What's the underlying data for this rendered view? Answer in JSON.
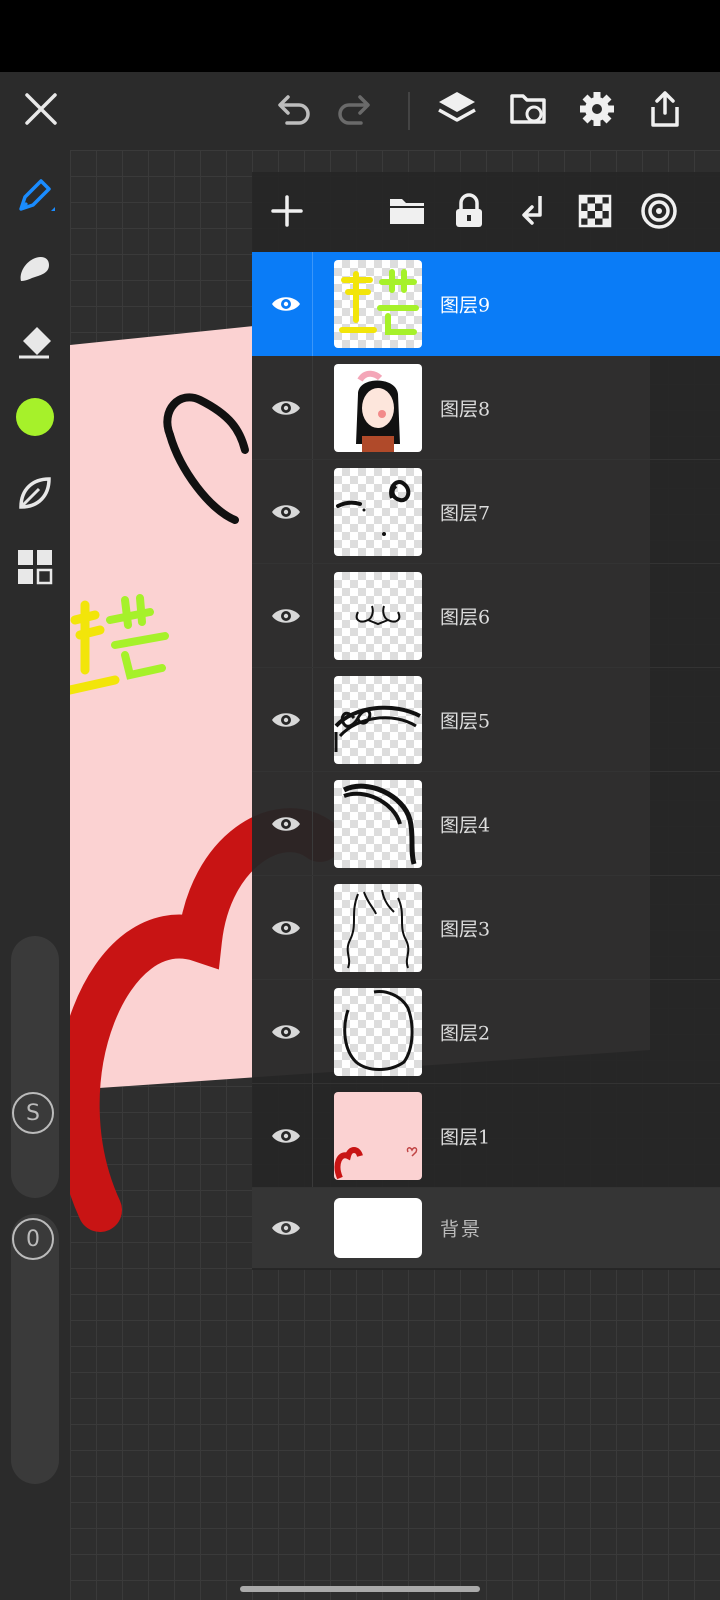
{
  "topbar": {
    "icons": [
      "close-icon",
      "undo-icon",
      "redo-icon",
      "layers-icon",
      "import-icon",
      "settings-icon",
      "share-icon"
    ]
  },
  "left_toolbar": {
    "tools": [
      "brush-icon",
      "smudge-icon",
      "eraser-icon",
      "color-swatch",
      "leaf-icon",
      "grid-icon"
    ],
    "current_color": "#a6f12a",
    "accent": "#1a8cff",
    "size_slider_label": "S",
    "opacity_slider_label": "0"
  },
  "layers_panel": {
    "tools": [
      "add-layer-icon",
      "folder-icon",
      "lock-icon",
      "merge-down-icon",
      "transparency-icon",
      "blend-icon"
    ],
    "selected_color": "#0a7cf7",
    "layers": [
      {
        "name": "图层9",
        "selected": true
      },
      {
        "name": "图层8",
        "selected": false
      },
      {
        "name": "图层7",
        "selected": false
      },
      {
        "name": "图层6",
        "selected": false
      },
      {
        "name": "图层5",
        "selected": false
      },
      {
        "name": "图层4",
        "selected": false
      },
      {
        "name": "图层3",
        "selected": false
      },
      {
        "name": "图层2",
        "selected": false
      },
      {
        "name": "图层1",
        "selected": false
      }
    ],
    "background_layer": {
      "name": "背景"
    }
  },
  "canvas": {
    "artwork_text": "墨芸"
  }
}
